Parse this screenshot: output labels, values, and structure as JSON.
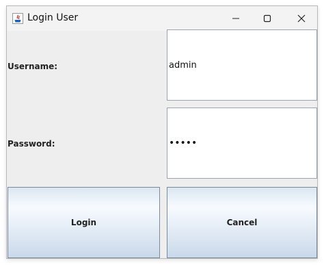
{
  "window": {
    "title": "Login User",
    "title_icon": "java-icon"
  },
  "titlebar_controls": [
    "minimize-icon",
    "maximize-icon",
    "close-icon"
  ],
  "form": {
    "username_label": "Username:",
    "username_value": "admin",
    "password_label": "Password:",
    "password_value": "•••••"
  },
  "buttons": {
    "login_label": "Login",
    "cancel_label": "Cancel"
  },
  "colors": {
    "window_bg": "#eeeeee",
    "titlebar_bg": "#f3f3f3",
    "field_border": "#9aa4b0",
    "button_gradient_top": "#dbe6f1",
    "button_gradient_bottom": "#c9d9ea"
  }
}
